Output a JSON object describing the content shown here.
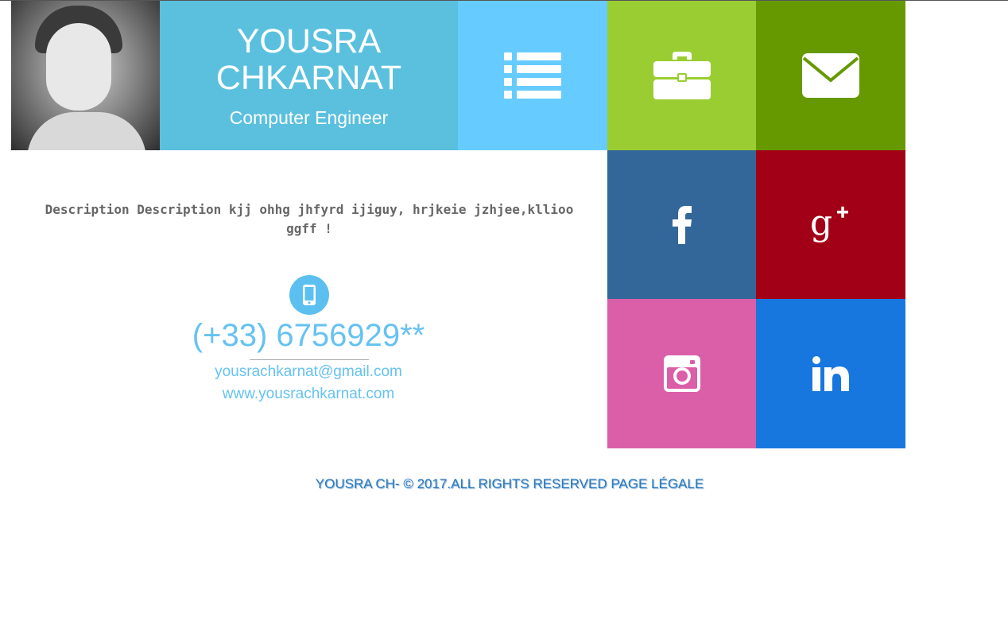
{
  "header": {
    "name": "YOUSRA CHKARNAT",
    "job_title": "Computer Engineer"
  },
  "tiles": [
    {
      "id": "list",
      "icon": "list-icon",
      "color": "#66ccff"
    },
    {
      "id": "portfolio",
      "icon": "briefcase-icon",
      "color": "#9acd32"
    },
    {
      "id": "contact",
      "icon": "envelope-icon",
      "color": "#669900"
    },
    {
      "id": "facebook",
      "icon": "facebook-icon",
      "color": "#336699"
    },
    {
      "id": "googleplus",
      "icon": "google-plus-icon",
      "color": "#a10016"
    },
    {
      "id": "instagram",
      "icon": "instagram-icon",
      "color": "#db5fa8"
    },
    {
      "id": "linkedin",
      "icon": "linkedin-icon",
      "color": "#1877df"
    }
  ],
  "profile": {
    "description": "Description Description kjj ohhg jhfyrd ijiguy, hrjkeie jzhjee,kllioo ggff !",
    "phone": "(+33) 6756929**",
    "email": "yousrachkarnat@gmail.com",
    "website": "www.yousrachkarnat.com"
  },
  "footer": {
    "text": "YOUSRA CH- © 2017.ALL RIGHTS RESERVED PAGE LÉGALE"
  },
  "colors": {
    "name_box": "#5bc0de",
    "accent_text": "#66c2f2",
    "footer_text": "#2b7abf"
  }
}
